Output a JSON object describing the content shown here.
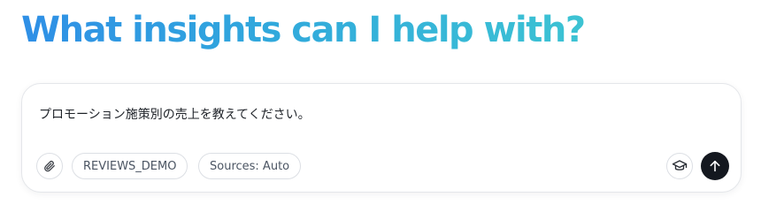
{
  "headline": "What insights can I help with?",
  "colors": {
    "headline_gradient_start": "#2f8fe6",
    "headline_gradient_end": "#3cc3d3",
    "send_button_bg": "#14181f",
    "chip_border": "#dcdfe4"
  },
  "composer": {
    "text": "プロモーション施策別の売上を教えてください。",
    "chips": {
      "dataset": "REVIEWS_DEMO",
      "sources": "Sources: Auto"
    },
    "icons": {
      "attach": "paperclip-icon",
      "learn": "graduation-cap-icon",
      "send": "arrow-up-icon"
    }
  }
}
